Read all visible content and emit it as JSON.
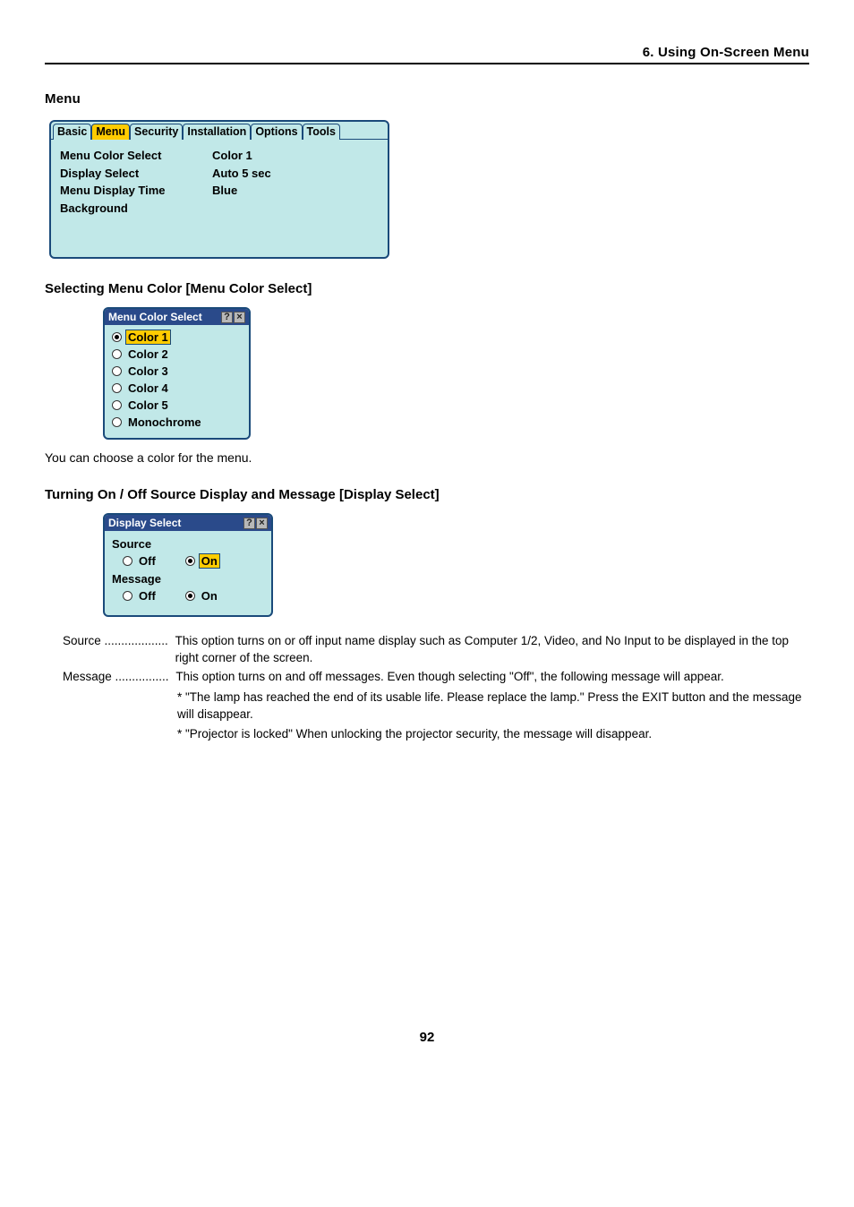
{
  "header": {
    "chapter": "6. Using On-Screen Menu"
  },
  "section": {
    "menu": "Menu"
  },
  "osd": {
    "tabs": [
      "Basic",
      "Menu",
      "Security",
      "Installation",
      "Options",
      "Tools"
    ],
    "tab_selected_index": 1,
    "rows": {
      "labels": [
        "Menu Color Select",
        "Display Select",
        "Menu Display Time",
        "Background"
      ],
      "values": [
        "Color 1",
        "",
        "Auto 5 sec",
        "Blue"
      ]
    }
  },
  "subheadings": {
    "color_select": "Selecting Menu Color [Menu Color Select]",
    "display_select": "Turning On / Off Source Display and Message [Display Select]"
  },
  "color_popup": {
    "title": "Menu Color Select",
    "options": [
      "Color 1",
      "Color 2",
      "Color 3",
      "Color 4",
      "Color 5",
      "Monochrome"
    ],
    "selected_index": 0
  },
  "body_text": {
    "color_choose": "You can choose a color for the menu."
  },
  "display_popup": {
    "title": "Display Select",
    "groups": [
      {
        "label": "Source",
        "off": "Off",
        "on": "On",
        "selected": "on",
        "highlight": true
      },
      {
        "label": "Message",
        "off": "Off",
        "on": "On",
        "selected": "on",
        "highlight": false
      }
    ]
  },
  "definitions": {
    "source": {
      "term": "Source",
      "dots": "...................",
      "desc": "This option turns on or off input name display such as Computer 1/2, Video, and No Input to be displayed in the top right corner of the screen."
    },
    "message": {
      "term": "Message",
      "dots": "................",
      "desc": "This option turns on and off messages. Even though selecting \"Off\", the following message will appear."
    },
    "note1": "* \"The lamp has reached the end of its usable life. Please replace the lamp.\" Press the EXIT button and the message will disappear.",
    "note2": "* \"Projector is locked\" When unlocking the projector security, the message will disappear."
  },
  "page_number": "92"
}
